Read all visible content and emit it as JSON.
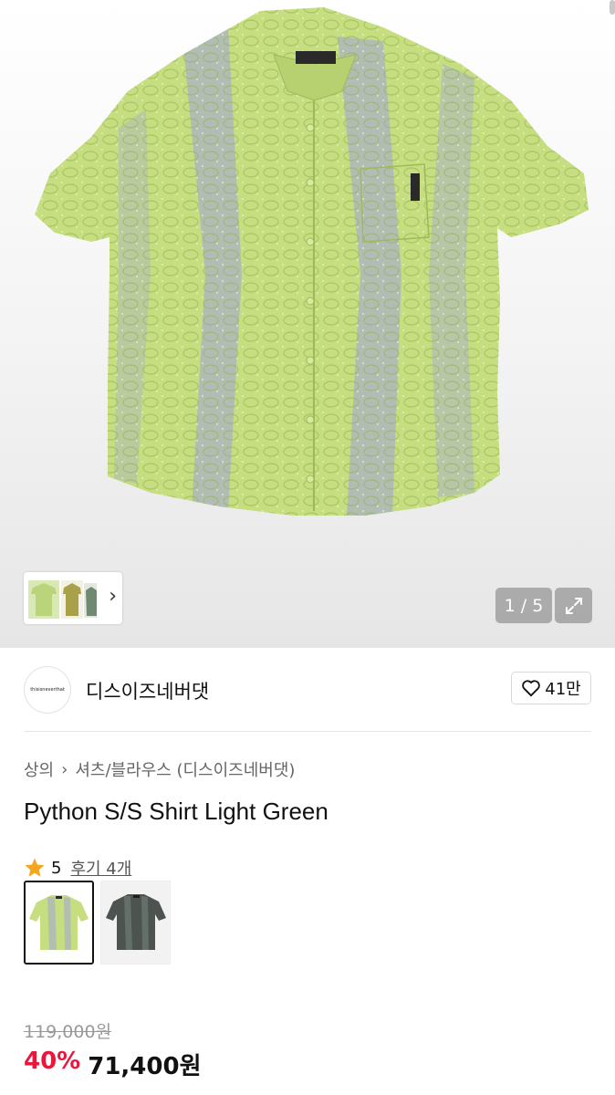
{
  "gallery": {
    "counter": "1 / 5",
    "thumb_next": "›"
  },
  "brand": {
    "logo_text": "thisisneverthat",
    "name": "디스이즈네버댓",
    "likes": "41만"
  },
  "breadcrumb": {
    "category": "상의",
    "separator": "›",
    "subcategory": "셔츠/블라우스 (디스이즈네버댓)"
  },
  "product": {
    "title": "Python S/S Shirt Light Green",
    "rating": "5",
    "reviews": "후기 4개"
  },
  "color_options": [
    {
      "name": "light-green",
      "selected": true
    },
    {
      "name": "charcoal",
      "selected": false
    }
  ],
  "price": {
    "original": "119,000원",
    "discount": "40%",
    "final": "71,400원"
  },
  "colors": {
    "accent_red": "#e8173b",
    "star": "#f5a623",
    "shirt_green": "#c3dd7c",
    "shirt_lavender": "#a9b3c2"
  }
}
